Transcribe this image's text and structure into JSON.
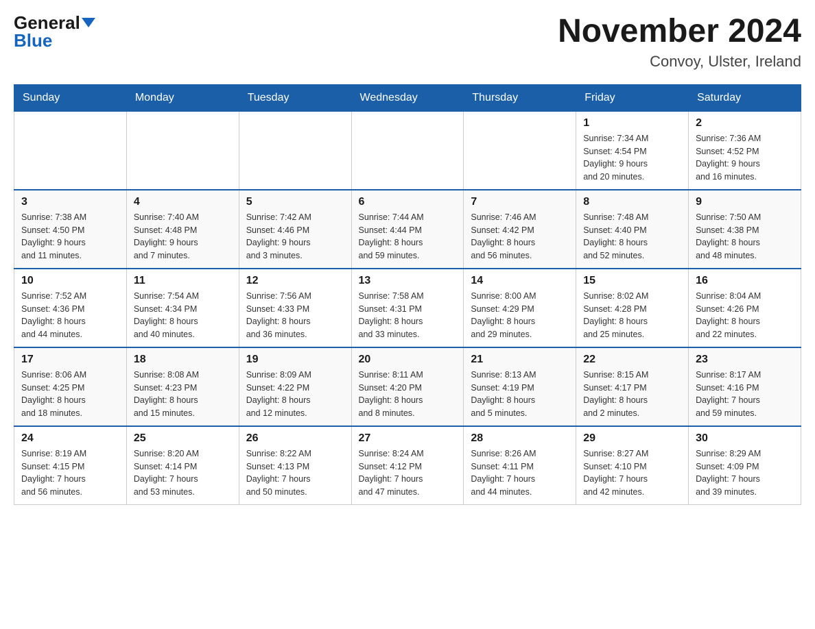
{
  "logo": {
    "general": "General",
    "blue": "Blue"
  },
  "title": "November 2024",
  "subtitle": "Convoy, Ulster, Ireland",
  "days_header": [
    "Sunday",
    "Monday",
    "Tuesday",
    "Wednesday",
    "Thursday",
    "Friday",
    "Saturday"
  ],
  "weeks": [
    [
      {
        "day": "",
        "info": ""
      },
      {
        "day": "",
        "info": ""
      },
      {
        "day": "",
        "info": ""
      },
      {
        "day": "",
        "info": ""
      },
      {
        "day": "",
        "info": ""
      },
      {
        "day": "1",
        "info": "Sunrise: 7:34 AM\nSunset: 4:54 PM\nDaylight: 9 hours\nand 20 minutes."
      },
      {
        "day": "2",
        "info": "Sunrise: 7:36 AM\nSunset: 4:52 PM\nDaylight: 9 hours\nand 16 minutes."
      }
    ],
    [
      {
        "day": "3",
        "info": "Sunrise: 7:38 AM\nSunset: 4:50 PM\nDaylight: 9 hours\nand 11 minutes."
      },
      {
        "day": "4",
        "info": "Sunrise: 7:40 AM\nSunset: 4:48 PM\nDaylight: 9 hours\nand 7 minutes."
      },
      {
        "day": "5",
        "info": "Sunrise: 7:42 AM\nSunset: 4:46 PM\nDaylight: 9 hours\nand 3 minutes."
      },
      {
        "day": "6",
        "info": "Sunrise: 7:44 AM\nSunset: 4:44 PM\nDaylight: 8 hours\nand 59 minutes."
      },
      {
        "day": "7",
        "info": "Sunrise: 7:46 AM\nSunset: 4:42 PM\nDaylight: 8 hours\nand 56 minutes."
      },
      {
        "day": "8",
        "info": "Sunrise: 7:48 AM\nSunset: 4:40 PM\nDaylight: 8 hours\nand 52 minutes."
      },
      {
        "day": "9",
        "info": "Sunrise: 7:50 AM\nSunset: 4:38 PM\nDaylight: 8 hours\nand 48 minutes."
      }
    ],
    [
      {
        "day": "10",
        "info": "Sunrise: 7:52 AM\nSunset: 4:36 PM\nDaylight: 8 hours\nand 44 minutes."
      },
      {
        "day": "11",
        "info": "Sunrise: 7:54 AM\nSunset: 4:34 PM\nDaylight: 8 hours\nand 40 minutes."
      },
      {
        "day": "12",
        "info": "Sunrise: 7:56 AM\nSunset: 4:33 PM\nDaylight: 8 hours\nand 36 minutes."
      },
      {
        "day": "13",
        "info": "Sunrise: 7:58 AM\nSunset: 4:31 PM\nDaylight: 8 hours\nand 33 minutes."
      },
      {
        "day": "14",
        "info": "Sunrise: 8:00 AM\nSunset: 4:29 PM\nDaylight: 8 hours\nand 29 minutes."
      },
      {
        "day": "15",
        "info": "Sunrise: 8:02 AM\nSunset: 4:28 PM\nDaylight: 8 hours\nand 25 minutes."
      },
      {
        "day": "16",
        "info": "Sunrise: 8:04 AM\nSunset: 4:26 PM\nDaylight: 8 hours\nand 22 minutes."
      }
    ],
    [
      {
        "day": "17",
        "info": "Sunrise: 8:06 AM\nSunset: 4:25 PM\nDaylight: 8 hours\nand 18 minutes."
      },
      {
        "day": "18",
        "info": "Sunrise: 8:08 AM\nSunset: 4:23 PM\nDaylight: 8 hours\nand 15 minutes."
      },
      {
        "day": "19",
        "info": "Sunrise: 8:09 AM\nSunset: 4:22 PM\nDaylight: 8 hours\nand 12 minutes."
      },
      {
        "day": "20",
        "info": "Sunrise: 8:11 AM\nSunset: 4:20 PM\nDaylight: 8 hours\nand 8 minutes."
      },
      {
        "day": "21",
        "info": "Sunrise: 8:13 AM\nSunset: 4:19 PM\nDaylight: 8 hours\nand 5 minutes."
      },
      {
        "day": "22",
        "info": "Sunrise: 8:15 AM\nSunset: 4:17 PM\nDaylight: 8 hours\nand 2 minutes."
      },
      {
        "day": "23",
        "info": "Sunrise: 8:17 AM\nSunset: 4:16 PM\nDaylight: 7 hours\nand 59 minutes."
      }
    ],
    [
      {
        "day": "24",
        "info": "Sunrise: 8:19 AM\nSunset: 4:15 PM\nDaylight: 7 hours\nand 56 minutes."
      },
      {
        "day": "25",
        "info": "Sunrise: 8:20 AM\nSunset: 4:14 PM\nDaylight: 7 hours\nand 53 minutes."
      },
      {
        "day": "26",
        "info": "Sunrise: 8:22 AM\nSunset: 4:13 PM\nDaylight: 7 hours\nand 50 minutes."
      },
      {
        "day": "27",
        "info": "Sunrise: 8:24 AM\nSunset: 4:12 PM\nDaylight: 7 hours\nand 47 minutes."
      },
      {
        "day": "28",
        "info": "Sunrise: 8:26 AM\nSunset: 4:11 PM\nDaylight: 7 hours\nand 44 minutes."
      },
      {
        "day": "29",
        "info": "Sunrise: 8:27 AM\nSunset: 4:10 PM\nDaylight: 7 hours\nand 42 minutes."
      },
      {
        "day": "30",
        "info": "Sunrise: 8:29 AM\nSunset: 4:09 PM\nDaylight: 7 hours\nand 39 minutes."
      }
    ]
  ]
}
